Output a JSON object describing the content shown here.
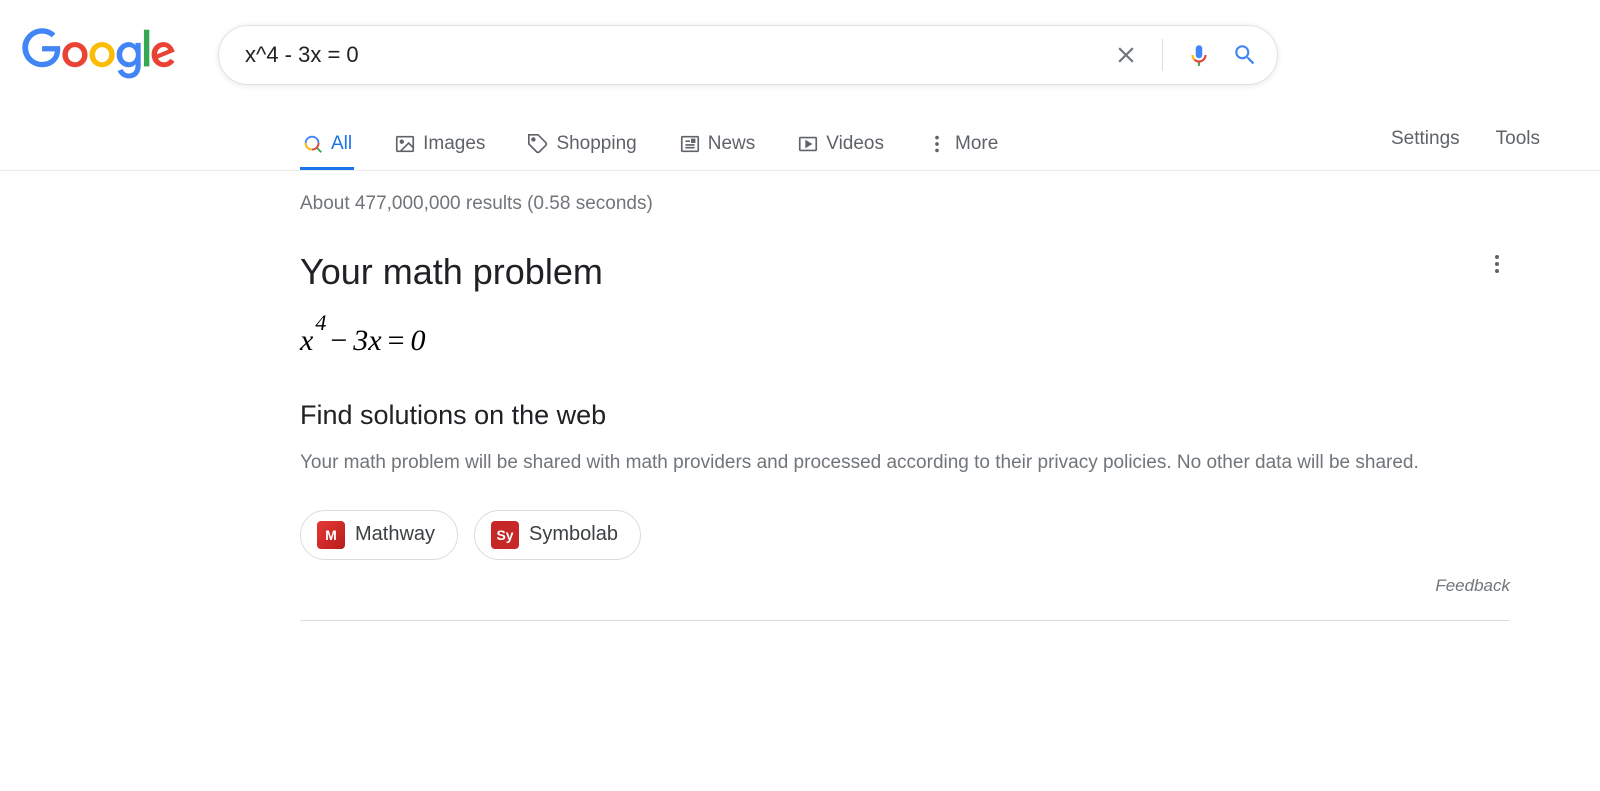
{
  "search": {
    "query": "x^4 - 3x = 0"
  },
  "tabs": {
    "all": "All",
    "images": "Images",
    "shopping": "Shopping",
    "news": "News",
    "videos": "Videos",
    "more": "More"
  },
  "tools": {
    "settings": "Settings",
    "tools": "Tools"
  },
  "stats": "About 477,000,000 results (0.58 seconds)",
  "math": {
    "title": "Your math problem",
    "find_title": "Find solutions on the web",
    "disclaimer": "Your math problem will be shared with math providers and processed according to their privacy policies. No other data will be shared.",
    "providers": {
      "mathway": "Mathway",
      "symbolab": "Symbolab",
      "mathway_icon": "M",
      "symbolab_icon": "Sy"
    }
  },
  "feedback": "Feedback"
}
